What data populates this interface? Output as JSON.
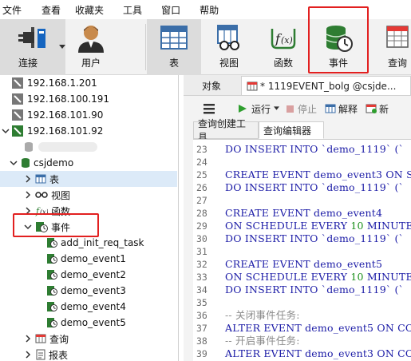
{
  "menubar": {
    "items": [
      "文件",
      "查看",
      "收藏夹",
      "工具",
      "窗口",
      "帮助"
    ]
  },
  "toolbar": {
    "buttons": [
      {
        "label": "连接",
        "icon": "plug-icon"
      },
      {
        "label": "用户",
        "icon": "user-icon"
      },
      {
        "label": "表",
        "icon": "table-icon"
      },
      {
        "label": "视图",
        "icon": "view-icon"
      },
      {
        "label": "函数",
        "icon": "function-icon"
      },
      {
        "label": "事件",
        "icon": "event-icon"
      },
      {
        "label": "查询",
        "icon": "query-icon"
      }
    ],
    "highlight_color": "#e22020"
  },
  "sidebar": {
    "connections": [
      "192.168.1.201",
      "192.168.100.191",
      "192.168.101.90",
      "192.168.101.92"
    ],
    "database": "csjdemo",
    "nodes": {
      "tables": "表",
      "views": "视图",
      "functions": "函数",
      "events": "事件",
      "queries": "查询",
      "reports": "报表"
    },
    "events": [
      "add_init_req_task",
      "demo_event1",
      "demo_event2",
      "demo_event3",
      "demo_event4",
      "demo_event5"
    ]
  },
  "rightpane": {
    "tabs": [
      "对象",
      "* 1119EVENT_bolg @csjde..."
    ],
    "query_toolbar": {
      "run": "运行",
      "stop": "停止",
      "explain": "解释",
      "new": "新"
    },
    "subtabs": [
      "查询创建工具",
      "查询编辑器"
    ],
    "code_lines": [
      {
        "n": "23",
        "parts": [
          {
            "t": "DO INSERT INTO",
            "c": "kw"
          },
          {
            "t": " `demo_1119` (`",
            "c": "plain"
          }
        ]
      },
      {
        "n": "24",
        "parts": []
      },
      {
        "n": "25",
        "parts": [
          {
            "t": "CREATE EVENT",
            "c": "kw"
          },
          {
            "t": " demo_event3 ",
            "c": "plain"
          },
          {
            "t": "ON S",
            "c": "kw"
          }
        ]
      },
      {
        "n": "26",
        "parts": [
          {
            "t": "DO INSERT INTO",
            "c": "kw"
          },
          {
            "t": " `demo_1119` (`",
            "c": "plain"
          }
        ]
      },
      {
        "n": "27",
        "parts": []
      },
      {
        "n": "28",
        "parts": [
          {
            "t": "CREATE EVENT",
            "c": "kw"
          },
          {
            "t": " demo_event4",
            "c": "plain"
          }
        ]
      },
      {
        "n": "29",
        "parts": [
          {
            "t": "ON SCHEDULE EVERY ",
            "c": "kw"
          },
          {
            "t": "10",
            "c": "num"
          },
          {
            "t": " MINUTE S",
            "c": "kw"
          }
        ]
      },
      {
        "n": "30",
        "parts": [
          {
            "t": "DO INSERT INTO",
            "c": "kw"
          },
          {
            "t": " `demo_1119` (`",
            "c": "plain"
          }
        ]
      },
      {
        "n": "31",
        "parts": []
      },
      {
        "n": "32",
        "parts": [
          {
            "t": "CREATE EVENT",
            "c": "kw"
          },
          {
            "t": " demo_event5",
            "c": "plain"
          }
        ]
      },
      {
        "n": "33",
        "parts": [
          {
            "t": "ON SCHEDULE EVERY ",
            "c": "kw"
          },
          {
            "t": "10",
            "c": "num"
          },
          {
            "t": " MINUTE S",
            "c": "kw"
          }
        ]
      },
      {
        "n": "34",
        "parts": [
          {
            "t": "DO INSERT INTO",
            "c": "kw"
          },
          {
            "t": " `demo_1119` (`",
            "c": "plain"
          }
        ]
      },
      {
        "n": "35",
        "parts": []
      },
      {
        "n": "36",
        "parts": [
          {
            "t": "-- 关闭事件任务:",
            "c": "cmt"
          }
        ]
      },
      {
        "n": "37",
        "parts": [
          {
            "t": "ALTER EVENT",
            "c": "kw"
          },
          {
            "t": " demo_event5 ",
            "c": "plain"
          },
          {
            "t": "ON CO",
            "c": "kw"
          }
        ]
      },
      {
        "n": "38",
        "parts": [
          {
            "t": "-- 开启事件任务:",
            "c": "cmt"
          }
        ]
      },
      {
        "n": "39",
        "parts": [
          {
            "t": "ALTER EVENT",
            "c": "kw"
          },
          {
            "t": " demo_event3 ",
            "c": "plain"
          },
          {
            "t": "ON CO",
            "c": "kw"
          }
        ]
      }
    ]
  }
}
